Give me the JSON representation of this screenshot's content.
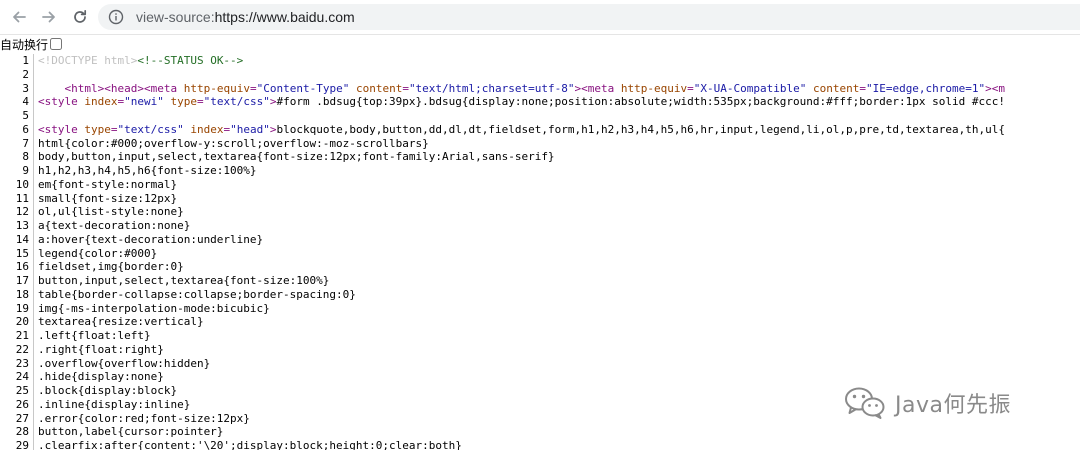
{
  "browser": {
    "url_scheme": "view-source:",
    "url_rest": "https://www.baidu.com"
  },
  "wrap": {
    "label": "自动换行",
    "checked": false
  },
  "source_lines": [
    {
      "n": "1",
      "parts": [
        [
          "doctype",
          "<!DOCTYPE html>"
        ],
        [
          "comment",
          "<!--STATUS OK-->"
        ]
      ]
    },
    {
      "n": "2",
      "parts": []
    },
    {
      "n": "3",
      "parts": [
        [
          "text",
          "    "
        ],
        [
          "tag",
          "<html>"
        ],
        [
          "tag",
          "<head>"
        ],
        [
          "tag",
          "<meta "
        ],
        [
          "attr",
          "http-equiv"
        ],
        [
          "tag",
          "="
        ],
        [
          "val",
          "\"Content-Type\""
        ],
        [
          "text",
          " "
        ],
        [
          "attr",
          "content"
        ],
        [
          "tag",
          "="
        ],
        [
          "val",
          "\"text/html;charset=utf-8\""
        ],
        [
          "tag",
          ">"
        ],
        [
          "tag",
          "<meta "
        ],
        [
          "attr",
          "http-equiv"
        ],
        [
          "tag",
          "="
        ],
        [
          "val",
          "\"X-UA-Compatible\""
        ],
        [
          "text",
          " "
        ],
        [
          "attr",
          "content"
        ],
        [
          "tag",
          "="
        ],
        [
          "val",
          "\"IE=edge,chrome=1\""
        ],
        [
          "tag",
          ">"
        ],
        [
          "tag",
          "<m"
        ]
      ]
    },
    {
      "n": "4",
      "parts": [
        [
          "tag",
          "<style "
        ],
        [
          "attr",
          "index"
        ],
        [
          "tag",
          "="
        ],
        [
          "val",
          "\"newi\""
        ],
        [
          "text",
          " "
        ],
        [
          "attr",
          "type"
        ],
        [
          "tag",
          "="
        ],
        [
          "val",
          "\"text/css\""
        ],
        [
          "tag",
          ">"
        ],
        [
          "text",
          "#form .bdsug{top:39px}.bdsug{display:none;position:absolute;width:535px;background:#fff;border:1px solid #ccc!"
        ]
      ]
    },
    {
      "n": "5",
      "parts": []
    },
    {
      "n": "6",
      "parts": [
        [
          "tag",
          "<style "
        ],
        [
          "attr",
          "type"
        ],
        [
          "tag",
          "="
        ],
        [
          "val",
          "\"text/css\""
        ],
        [
          "text",
          " "
        ],
        [
          "attr",
          "index"
        ],
        [
          "tag",
          "="
        ],
        [
          "val",
          "\"head\""
        ],
        [
          "tag",
          ">"
        ],
        [
          "text",
          "blockquote,body,button,dd,dl,dt,fieldset,form,h1,h2,h3,h4,h5,h6,hr,input,legend,li,ol,p,pre,td,textarea,th,ul{"
        ]
      ]
    },
    {
      "n": "7",
      "parts": [
        [
          "text",
          "html{color:#000;overflow-y:scroll;overflow:-moz-scrollbars}"
        ]
      ]
    },
    {
      "n": "8",
      "parts": [
        [
          "text",
          "body,button,input,select,textarea{font-size:12px;font-family:Arial,sans-serif}"
        ]
      ]
    },
    {
      "n": "9",
      "parts": [
        [
          "text",
          "h1,h2,h3,h4,h5,h6{font-size:100%}"
        ]
      ]
    },
    {
      "n": "10",
      "parts": [
        [
          "text",
          "em{font-style:normal}"
        ]
      ]
    },
    {
      "n": "11",
      "parts": [
        [
          "text",
          "small{font-size:12px}"
        ]
      ]
    },
    {
      "n": "12",
      "parts": [
        [
          "text",
          "ol,ul{list-style:none}"
        ]
      ]
    },
    {
      "n": "13",
      "parts": [
        [
          "text",
          "a{text-decoration:none}"
        ]
      ]
    },
    {
      "n": "14",
      "parts": [
        [
          "text",
          "a:hover{text-decoration:underline}"
        ]
      ]
    },
    {
      "n": "15",
      "parts": [
        [
          "text",
          "legend{color:#000}"
        ]
      ]
    },
    {
      "n": "16",
      "parts": [
        [
          "text",
          "fieldset,img{border:0}"
        ]
      ]
    },
    {
      "n": "17",
      "parts": [
        [
          "text",
          "button,input,select,textarea{font-size:100%}"
        ]
      ]
    },
    {
      "n": "18",
      "parts": [
        [
          "text",
          "table{border-collapse:collapse;border-spacing:0}"
        ]
      ]
    },
    {
      "n": "19",
      "parts": [
        [
          "text",
          "img{-ms-interpolation-mode:bicubic}"
        ]
      ]
    },
    {
      "n": "20",
      "parts": [
        [
          "text",
          "textarea{resize:vertical}"
        ]
      ]
    },
    {
      "n": "21",
      "parts": [
        [
          "text",
          ".left{float:left}"
        ]
      ]
    },
    {
      "n": "22",
      "parts": [
        [
          "text",
          ".right{float:right}"
        ]
      ]
    },
    {
      "n": "23",
      "parts": [
        [
          "text",
          ".overflow{overflow:hidden}"
        ]
      ]
    },
    {
      "n": "24",
      "parts": [
        [
          "text",
          ".hide{display:none}"
        ]
      ]
    },
    {
      "n": "25",
      "parts": [
        [
          "text",
          ".block{display:block}"
        ]
      ]
    },
    {
      "n": "26",
      "parts": [
        [
          "text",
          ".inline{display:inline}"
        ]
      ]
    },
    {
      "n": "27",
      "parts": [
        [
          "text",
          ".error{color:red;font-size:12px}"
        ]
      ]
    },
    {
      "n": "28",
      "parts": [
        [
          "text",
          "button,label{cursor:pointer}"
        ]
      ]
    },
    {
      "n": "29",
      "parts": [
        [
          "text",
          ".clearfix:after{content:'\\20';display:block;height:0;clear:both}"
        ]
      ]
    }
  ],
  "watermark": {
    "text": "Java何先振"
  },
  "colors": {
    "tag": "#881280",
    "attr": "#994500",
    "value": "#1a1aa6",
    "comment": "#236e25",
    "doctype": "#c0c0c0"
  },
  "icons": {
    "back": "arrow-left-icon",
    "forward": "arrow-right-icon",
    "reload": "reload-icon",
    "site_info": "info-circle-icon",
    "watermark_logo": "wechat-icon"
  }
}
